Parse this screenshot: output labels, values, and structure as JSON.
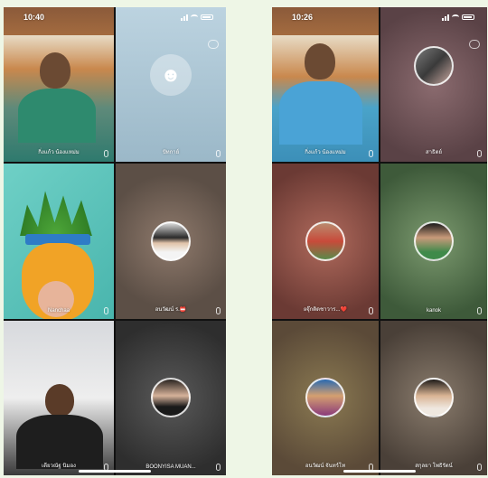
{
  "left_phone": {
    "time": "10:40",
    "tiles": [
      {
        "name": "กิ่งแก้ว น้องแหม่ม"
      },
      {
        "name": "ปัทกาย์"
      },
      {
        "name": "Nanchaa"
      },
      {
        "name": "อนวัฒน์ ร.📛"
      },
      {
        "name": "เดียวณัฐ นิมอง"
      },
      {
        "name": "BOONYISA MUAN..."
      }
    ]
  },
  "right_phone": {
    "time": "10:26",
    "tiles": [
      {
        "name": "กิ่งแก้ว น้องแหม่ม"
      },
      {
        "name": "สาธิตย์"
      },
      {
        "name": "ʚจุ๊กติดชาวาร...❤️"
      },
      {
        "name": "kanok"
      },
      {
        "name": "อนวัฒน์ จันทร์โท"
      },
      {
        "name": "สกุลยา โพธิรัตน์"
      }
    ]
  }
}
